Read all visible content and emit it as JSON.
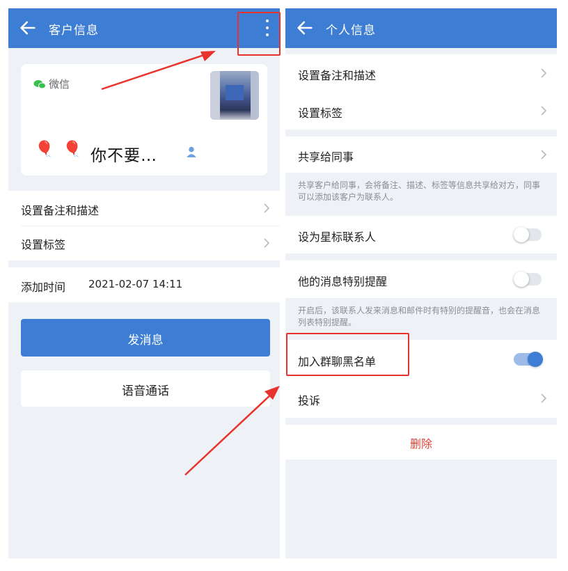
{
  "left": {
    "appbar": {
      "title": "客户信息",
      "back_icon": "arrow-left-icon",
      "more_icon": "more-vert-icon"
    },
    "profile": {
      "source_label": "微信",
      "source_icon": "wechat-icon",
      "name": "你不要…",
      "emoji": "🎈",
      "gender_icon": "person-icon",
      "avatar": "blurred-avatar"
    },
    "settings": [
      {
        "label": "设置备注和描述"
      },
      {
        "label": "设置标签"
      }
    ],
    "added_time": {
      "label": "添加时间",
      "value": "2021-02-07 14:11"
    },
    "buttons": {
      "message": "发消息",
      "voice_call": "语音通话"
    }
  },
  "right": {
    "appbar": {
      "title": "个人信息",
      "back_icon": "arrow-left-icon"
    },
    "items": {
      "remark": "设置备注和描述",
      "tags": "设置标签",
      "share": "共享给同事",
      "share_hint": "共享客户给同事，会将备注、描述、标签等信息共享给对方，同事可以添加该客户为联系人。",
      "star": "设为星标联系人",
      "remind": "他的消息特别提醒",
      "remind_hint": "开启后，该联系人发来消息和邮件时有特别的提醒音，也会在消息列表特别提醒。",
      "blacklist": "加入群聊黑名单",
      "complain": "投诉",
      "delete": "删除"
    },
    "toggles": {
      "star": false,
      "remind": false,
      "blacklist": true
    }
  },
  "colors": {
    "primary": "#3d7ed4",
    "annotation": "#e8322c",
    "delete": "#d9453a",
    "background": "#eef1f5"
  }
}
